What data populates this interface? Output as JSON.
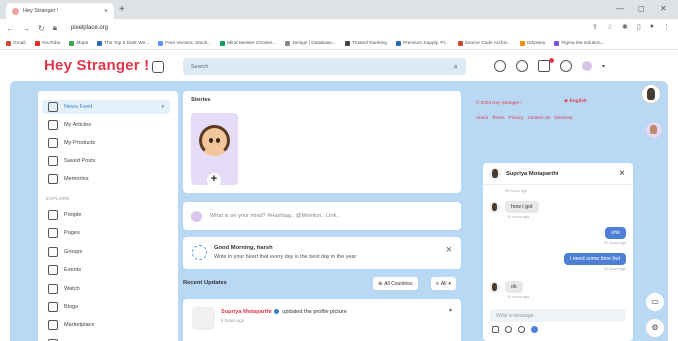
{
  "browser": {
    "tab_title": "Hey Stranger !",
    "new_tab": "+",
    "url": "pixelplace.org",
    "bookmarks": [
      "Gmail",
      "YouTube",
      "Maps",
      "The Top 5 Dark We...",
      "Free Vectors, Stock...",
      "Mind Meister Chosen...",
      "Design | Database...",
      "Trusted Ranking",
      "Premium Supply, Pl...",
      "Source Code Archiv...",
      "Odyssey",
      "Figma the solution..."
    ]
  },
  "header": {
    "logo": "Hey Stranger !",
    "search_placeholder": "Search"
  },
  "sidebar": {
    "items": [
      {
        "label": "News Feed",
        "active": true
      },
      {
        "label": "My Articles"
      },
      {
        "label": "My Products"
      },
      {
        "label": "Saved Posts"
      },
      {
        "label": "Memories"
      }
    ],
    "section": "EXPLORE",
    "explore": [
      {
        "label": "People"
      },
      {
        "label": "Pages"
      },
      {
        "label": "Groups"
      },
      {
        "label": "Events"
      },
      {
        "label": "Watch"
      },
      {
        "label": "Blogs"
      },
      {
        "label": "Marketplace"
      },
      {
        "label": "Offers"
      }
    ]
  },
  "stories": {
    "title": "Stories",
    "add": "+"
  },
  "post": {
    "placeholder": "What is on your mind? #Hashtag.. @Mention.. Link.."
  },
  "greeting": {
    "title": "Good Morning, harsh",
    "subtitle": "Write in your heart that every day is the best day in the year",
    "close": "×"
  },
  "recent": {
    "title": "Recent Updates",
    "filter1": "All Countries",
    "filter2": "All"
  },
  "feed": {
    "name": "Supriya Motaparthi",
    "action": "updated the profile picture",
    "time": "5 hours ago"
  },
  "right": {
    "copyright": "© 2022 Hey Stranger !",
    "language": "English",
    "links": [
      "About",
      "Terms",
      "Privacy",
      "Contact Us",
      "Directory"
    ]
  },
  "chat": {
    "name": "Supriya Motaparthi",
    "close": "×",
    "messages": [
      {
        "dir": "meta",
        "text": "20 hours ago"
      },
      {
        "dir": "in",
        "text": "how i got"
      },
      {
        "dir": "meta",
        "text": "20 hours ago"
      },
      {
        "dir": "out",
        "text": "ohk"
      },
      {
        "dir": "meta",
        "text": "20 hours ago"
      },
      {
        "dir": "out",
        "text": "i need some time but"
      },
      {
        "dir": "meta",
        "text": "20 hours ago"
      },
      {
        "dir": "in",
        "text": "ok"
      },
      {
        "dir": "meta",
        "text": "20 hours ago"
      }
    ],
    "input_placeholder": "Write a message"
  }
}
